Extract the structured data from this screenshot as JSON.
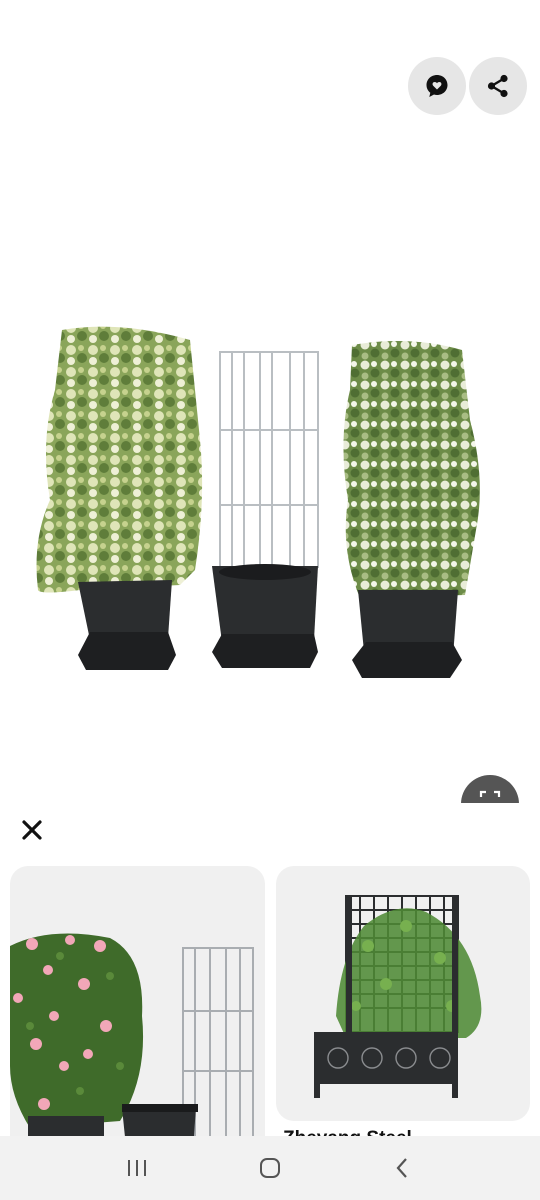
{
  "actions": {
    "visual_search_icon": "visual-search-icon",
    "share_icon": "share-icon",
    "scan_icon": "scan-icon",
    "close_icon": "close-icon"
  },
  "related": {
    "cards": [
      {
        "title": ""
      },
      {
        "title": "Zheyang Steel ..."
      }
    ]
  },
  "navbar": {
    "recent_icon": "recent-apps-icon",
    "home_icon": "home-icon",
    "back_icon": "back-icon"
  },
  "colors": {
    "fab_bg": "#e6e6e6",
    "card_bg": "#f0f0f0",
    "navbar_bg": "#f2f2f2",
    "pot": "#2b2d2f",
    "foliage": "#7c9a4e"
  }
}
